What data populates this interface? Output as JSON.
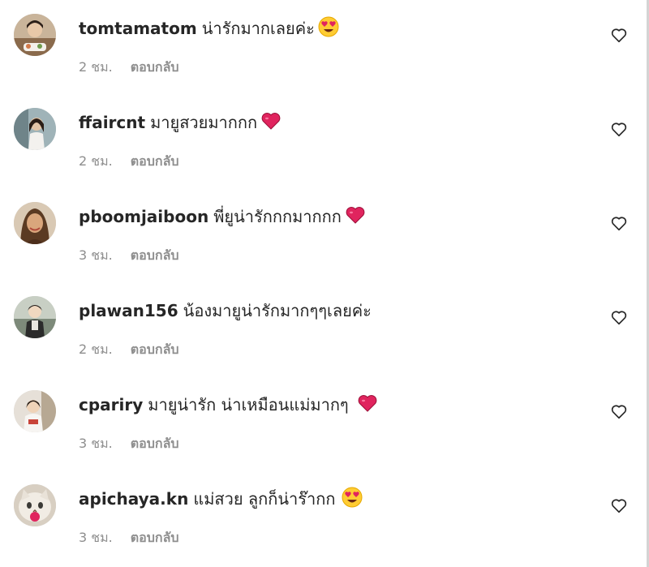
{
  "comments": [
    {
      "username": "tomtamatom",
      "text": "น่ารักมากเลยค่ะ",
      "emoji": "heart-eyes",
      "time": "2 ชม.",
      "reply_label": "ตอบกลับ"
    },
    {
      "username": "ffaircnt",
      "text": "มายูสวยมากกก",
      "emoji": "red-heart",
      "time": "2 ชม.",
      "reply_label": "ตอบกลับ"
    },
    {
      "username": "pboomjaiboon",
      "text": "พี่ยูน่ารักกกมากกก",
      "emoji": "red-heart",
      "time": "3 ชม.",
      "reply_label": "ตอบกลับ"
    },
    {
      "username": "plawan156",
      "text": "น้องมายูน่ารักมากๆๆเลยค่ะ",
      "emoji": "",
      "time": "2 ชม.",
      "reply_label": "ตอบกลับ"
    },
    {
      "username": "cpariry",
      "text": "มายูน่ารัก น่าเหมือนแม่มากๆ",
      "emoji": "red-heart",
      "time": "3 ชม.",
      "reply_label": "ตอบกลับ"
    },
    {
      "username": "apichaya.kn",
      "text": "แม่สวย ลูกก็น่าร๊ากก",
      "emoji": "heart-eyes",
      "time": "3 ชม.",
      "reply_label": "ตอบกลับ"
    }
  ],
  "colors": {
    "text": "#262626",
    "meta": "#8e8e8e",
    "heart_red": "#e0245e",
    "emoji_yellow": "#ffcc33"
  },
  "icons": {
    "like": "heart-outline-icon",
    "avatar": "avatar-photo"
  }
}
